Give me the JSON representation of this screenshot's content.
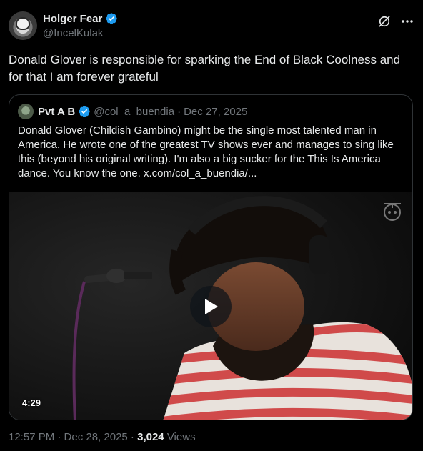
{
  "author": {
    "display_name": "Holger Fear",
    "handle": "@IncelKulak",
    "verified": true
  },
  "icons": {
    "verified": "verified-badge-icon",
    "grok": "grok-icon",
    "more": "more-icon",
    "play": "play-icon",
    "watermark": "triple-j-logo-icon"
  },
  "colors": {
    "background": "#000000",
    "text": "#e7e9ea",
    "secondary_text": "#71767b",
    "verified_blue": "#1d9bf0",
    "border": "#2f3336"
  },
  "tweet": {
    "text": "Donald Glover is responsible for sparking the End of Black Coolness and for that I am forever grateful"
  },
  "quote": {
    "display_name": "Pvt A B",
    "handle": "@col_a_buendia",
    "separator": "·",
    "date": "Dec 27, 2025",
    "verified": true,
    "text": "Donald Glover (Childish Gambino) might be the single most talented man in America. He wrote one of the greatest TV shows ever and manages to sing like this (beyond his original writing). I'm also a big sucker for the This Is America dance. You know the one.",
    "link": "x.com/col_a_buendia/...",
    "video": {
      "duration": "4:29"
    }
  },
  "meta": {
    "time_date": "12:57 PM · Dec 28, 2025 · ",
    "views_count": "3,024",
    "views_label": " Views"
  }
}
